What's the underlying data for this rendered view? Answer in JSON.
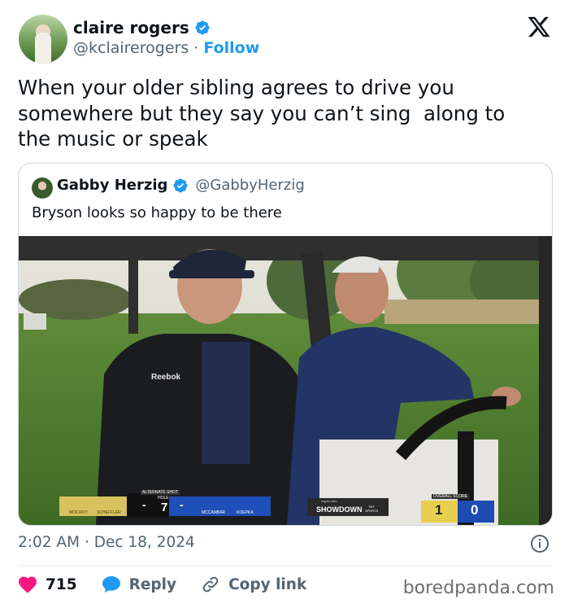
{
  "author": {
    "display_name": "claire rogers",
    "handle": "@kclairerogers",
    "separator": "·",
    "follow_label": "Follow",
    "verified_badge_icon": "verified-badge-icon"
  },
  "platform_logo": "x-logo-icon",
  "tweet": {
    "text": "When your older sibling agrees to drive you\nsomewhere but they say you can’t sing  along to\nthe music or speak"
  },
  "quoted_tweet": {
    "display_name": "Gabby Herzig",
    "handle": "@GabbyHerzig",
    "text": "Bryson looks so happy to be there",
    "media": {
      "scoreboard": {
        "alt_shot_label": "ALTERNATE SHOT",
        "hole_label": "HOLE",
        "hole_number": "7",
        "team_left": [
          "MCILROY",
          "SCHEFFLER"
        ],
        "team_right": [
          "MCCAMBAR",
          "KOEPKA"
        ],
        "left_marker": "-",
        "right_marker": "-",
        "broadcast_brand": "SHOWDOWN",
        "brand_prefix": "crypto.com",
        "network": "TNT SPORTS",
        "overall_label": "OVERALL SCORE",
        "score_left": "1",
        "score_right": "0"
      },
      "jacket_brand": "Reebok"
    }
  },
  "meta": {
    "time": "2:02 AM",
    "separator": "·",
    "date": "Dec 18, 2024"
  },
  "actions": {
    "likes": "715",
    "reply_label": "Reply",
    "copy_link_label": "Copy link"
  },
  "watermark": "boredpanda.com",
  "colors": {
    "accent": "#1d9bf0",
    "like": "#f91880",
    "text_secondary": "#536471"
  }
}
